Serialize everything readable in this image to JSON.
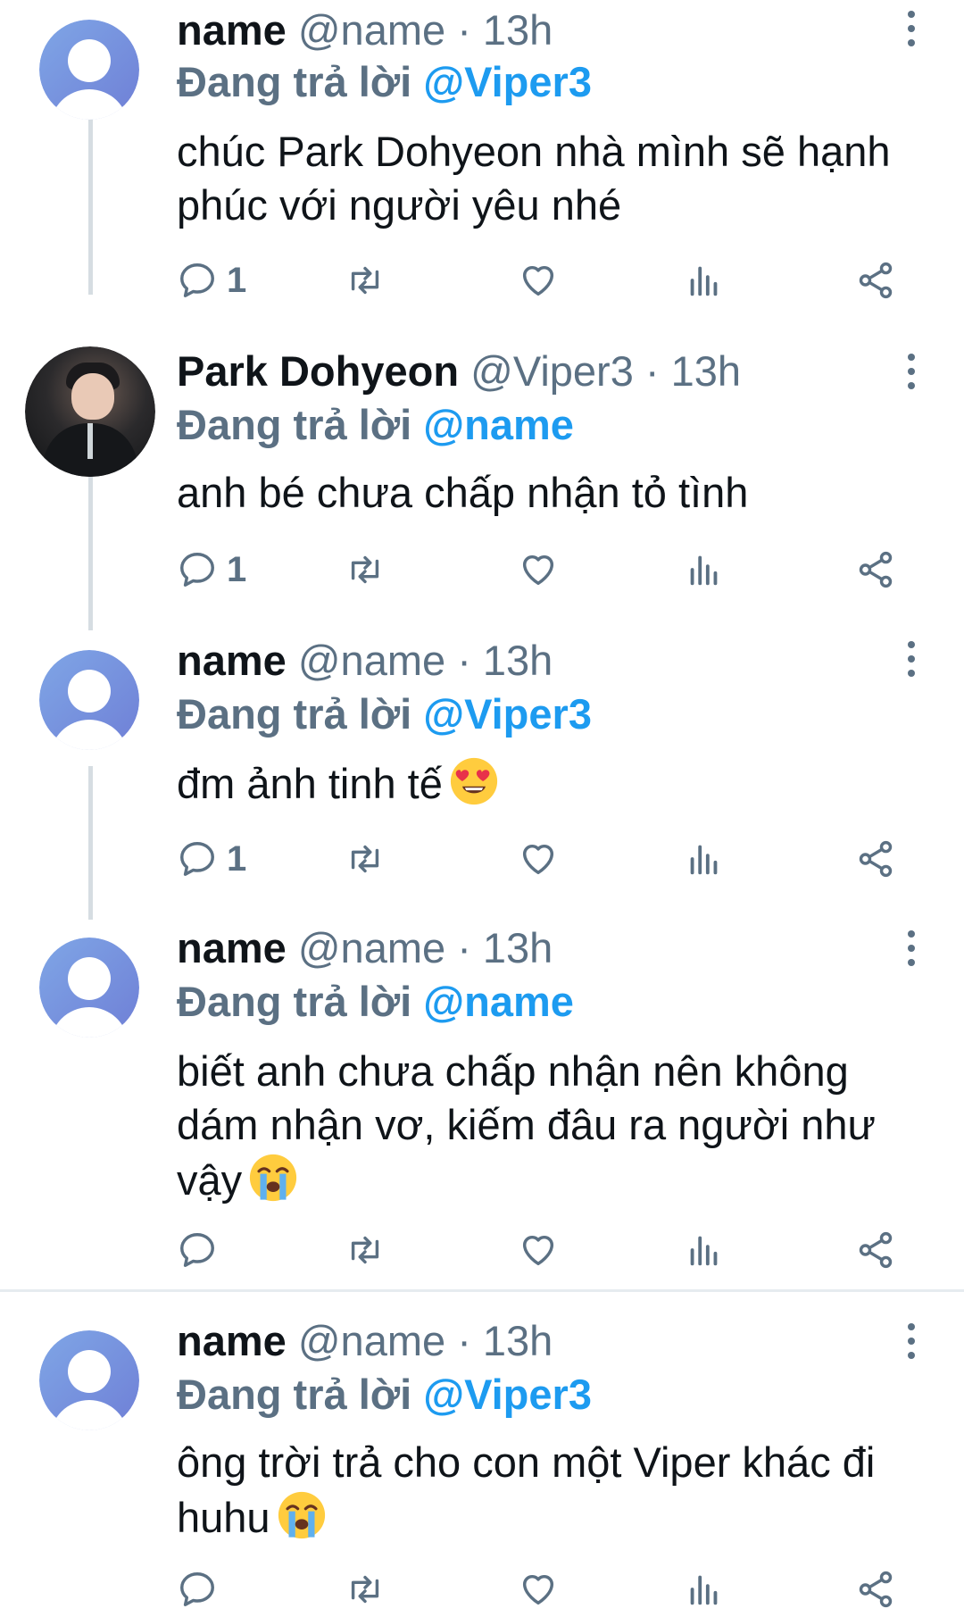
{
  "tweets": [
    {
      "name": "name",
      "handle": "@name",
      "sep": "·",
      "time": "13h",
      "reply_prefix": "Đang trả lời",
      "reply_to": "@Viper3",
      "content": "chúc Park Dohyeon nhà mình sẽ hạnh phúc với người yêu nhé",
      "emoji": "",
      "reply_count": "1",
      "avatar": "default-avatar"
    },
    {
      "name": "Park Dohyeon",
      "handle": "@Viper3",
      "sep": "·",
      "time": "13h",
      "reply_prefix": "Đang trả lời",
      "reply_to": "@name",
      "content": "anh bé chưa chấp nhận tỏ tình",
      "emoji": "",
      "reply_count": "1",
      "avatar": "profile-photo"
    },
    {
      "name": "name",
      "handle": "@name",
      "sep": "·",
      "time": "13h",
      "reply_prefix": "Đang trả lời",
      "reply_to": "@Viper3",
      "content": "đm ảnh tinh tế",
      "emoji": "heart-eyes-emoji",
      "reply_count": "1",
      "avatar": "default-avatar"
    },
    {
      "name": "name",
      "handle": "@name",
      "sep": "·",
      "time": "13h",
      "reply_prefix": "Đang trả lời",
      "reply_to": "@name",
      "content": "biết anh chưa chấp nhận nên không dám nhận vơ, kiếm đâu ra người như vậy",
      "emoji": "loudly-crying-emoji",
      "reply_count": "",
      "avatar": "default-avatar"
    },
    {
      "name": "name",
      "handle": "@name",
      "sep": "·",
      "time": "13h",
      "reply_prefix": "Đang trả lời",
      "reply_to": "@Viper3",
      "content": "ông trời trả cho con một Viper khác đi huhu",
      "emoji": "loudly-crying-emoji",
      "reply_count": "",
      "avatar": "default-avatar"
    }
  ],
  "colors": {
    "text": "#0f1419",
    "secondary": "#5b7083",
    "accent": "#1d9bf0",
    "thread_line": "#d6dde2"
  }
}
